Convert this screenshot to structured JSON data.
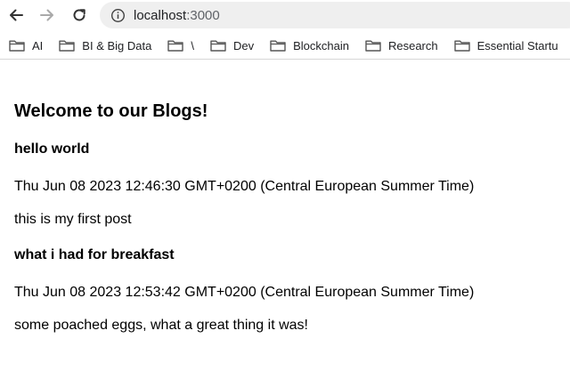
{
  "browser": {
    "url_host": "localhost",
    "url_port": ":3000",
    "bookmarks": [
      {
        "label": "AI"
      },
      {
        "label": "BI & Big Data"
      },
      {
        "label": "\\"
      },
      {
        "label": "Dev"
      },
      {
        "label": "Blockchain"
      },
      {
        "label": "Research"
      },
      {
        "label": "Essential Startu"
      }
    ]
  },
  "page": {
    "title": "Welcome to our Blogs!",
    "posts": [
      {
        "title": "hello world",
        "date": "Thu Jun 08 2023 12:46:30 GMT+0200 (Central European Summer Time)",
        "body": "this is my first post"
      },
      {
        "title": "what i had for breakfast",
        "date": "Thu Jun 08 2023 12:53:42 GMT+0200 (Central European Summer Time)",
        "body": "some poached eggs, what a great thing it was!"
      }
    ]
  }
}
